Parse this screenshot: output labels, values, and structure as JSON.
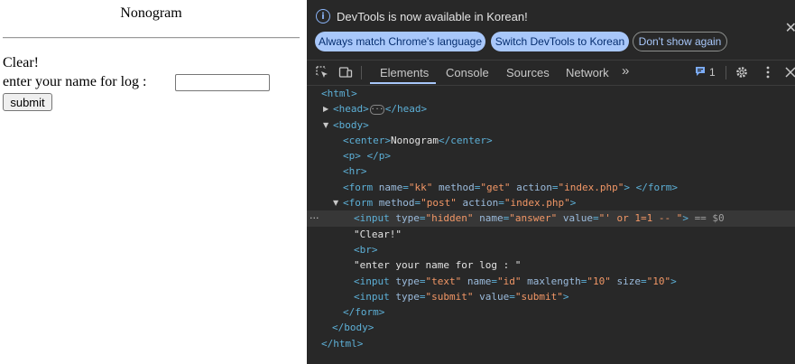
{
  "page": {
    "title": "Nonogram",
    "clear_text": "Clear!",
    "name_label": "enter your name for log :",
    "name_value": "",
    "submit_label": "submit"
  },
  "devtools": {
    "notice": "DevTools is now available in Korean!",
    "btn_match": "Always match Chrome's language",
    "btn_switch": "Switch DevTools to Korean",
    "btn_dont_show": "Don't show again",
    "tabs": [
      "Elements",
      "Console",
      "Sources",
      "Network"
    ],
    "more_tabs": "»",
    "issues_count": "1",
    "colors": {
      "accent": "#a8c7fa",
      "bg": "#282828",
      "tag": "#5db0d7",
      "attr": "#9bbbdc",
      "value": "#f29766"
    },
    "dom": {
      "l1": "<html>",
      "l2a": "<head>",
      "l2b": "</head>",
      "l3": "<body>",
      "l4": {
        "open": "<center>",
        "text": "Nonogram",
        "close": "</center>"
      },
      "l5": {
        "open": "<p>",
        "text": " ",
        "close": "</p>"
      },
      "l6": "<hr>",
      "l7": {
        "tag": "<form",
        "a1": "name",
        "v1": "\"kk\"",
        "a2": "method",
        "v2": "\"get\"",
        "a3": "action",
        "v3": "\"index.php\"",
        "end": ">",
        "close": "</form>"
      },
      "l8": {
        "tag": "<form",
        "a1": "method",
        "v1": "\"post\"",
        "a2": "action",
        "v2": "\"index.php\"",
        "end": ">"
      },
      "l9": {
        "tag": "<input",
        "a1": "type",
        "v1": "\"hidden\"",
        "a2": "name",
        "v2": "\"answer\"",
        "a3": "value",
        "v3": "\"' or 1=1 -- \"",
        "end": ">",
        "ref": "== $0"
      },
      "l10": "\"Clear!\"",
      "l11": "<br>",
      "l12": "\"enter your name for log : \"",
      "l13": {
        "tag": "<input",
        "a1": "type",
        "v1": "\"text\"",
        "a2": "name",
        "v2": "\"id\"",
        "a3": "maxlength",
        "v3": "\"10\"",
        "a4": "size",
        "v4": "\"10\"",
        "end": ">"
      },
      "l14": {
        "tag": "<input",
        "a1": "type",
        "v1": "\"submit\"",
        "a2": "value",
        "v2": "\"submit\"",
        "end": ">"
      },
      "l15": "</form>",
      "l16": "</body>",
      "l17": "</html>"
    }
  }
}
